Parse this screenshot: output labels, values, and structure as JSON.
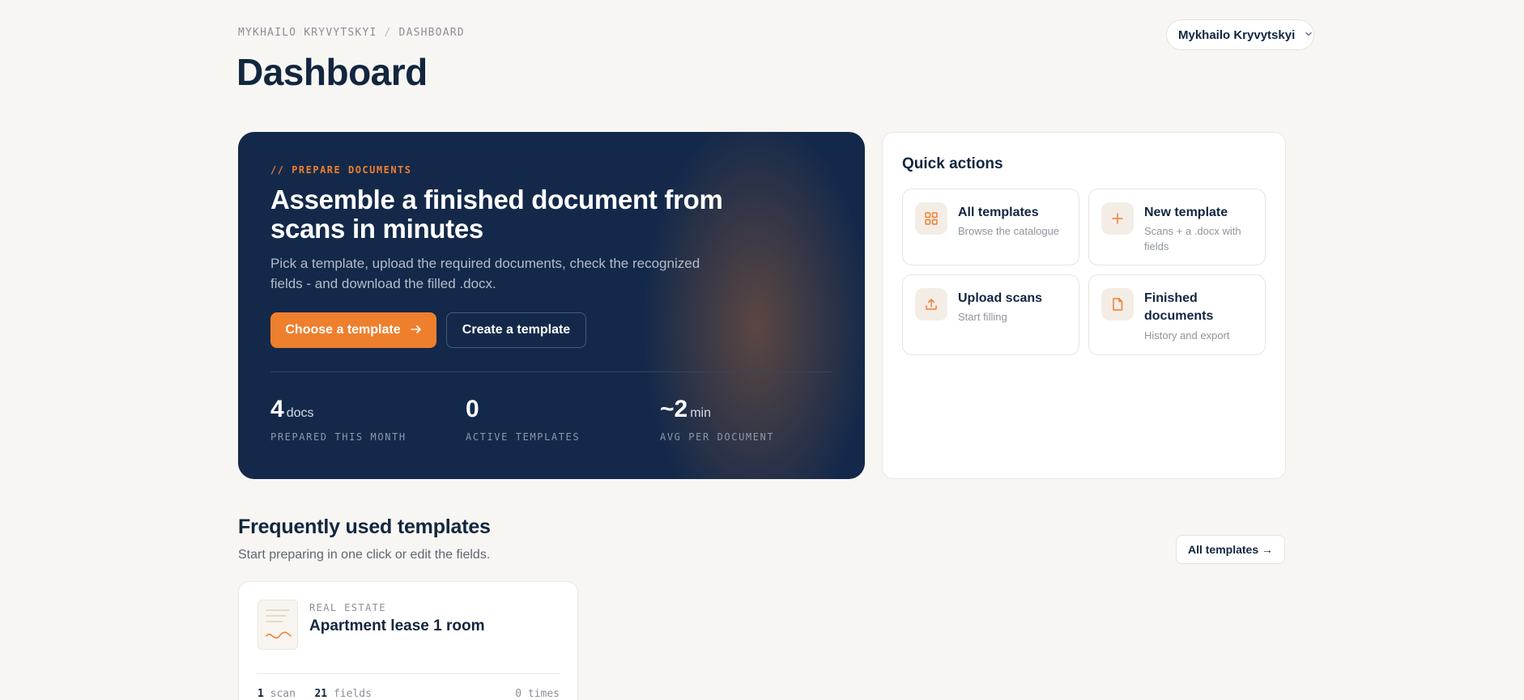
{
  "breadcrumb": {
    "user": "MYKHAILO KRYVYTSKYI",
    "separator": "/",
    "current": "DASHBOARD"
  },
  "page_title": "Dashboard",
  "user_menu": {
    "name": "Mykhailo Kryvytskyi",
    "icon": "chevron-down-icon"
  },
  "hero": {
    "eyebrow": "// PREPARE DOCUMENTS",
    "title": "Assemble a finished document from scans in minutes",
    "description": "Pick a template, upload the required documents, check the recognized fields - and download the filled .docx.",
    "primary_button": "Choose a template",
    "primary_button_icon": "arrow-right-icon",
    "secondary_button": "Create a template",
    "stats": [
      {
        "value": "4",
        "unit": "docs",
        "label": "PREPARED THIS MONTH"
      },
      {
        "value": "0",
        "unit": "",
        "label": "ACTIVE TEMPLATES"
      },
      {
        "value": "~2",
        "unit": "min",
        "label": "AVG PER DOCUMENT"
      }
    ]
  },
  "quick_actions": {
    "title": "Quick actions",
    "items": [
      {
        "title": "All templates",
        "subtitle": "Browse the catalogue",
        "icon": "grid-icon"
      },
      {
        "title": "New template",
        "subtitle": "Scans + a .docx with fields",
        "icon": "plus-icon"
      },
      {
        "title": "Upload scans",
        "subtitle": "Start filling",
        "icon": "upload-icon"
      },
      {
        "title": "Finished documents",
        "subtitle": "History and export",
        "icon": "document-icon"
      }
    ]
  },
  "frequent": {
    "title": "Frequently used templates",
    "subtitle": "Start preparing in one click or edit the fields.",
    "all_button": "All templates →",
    "templates": [
      {
        "category": "REAL ESTATE",
        "name": "Apartment lease 1 room",
        "scans_count": "1",
        "scans_label": "scan",
        "fields_count": "21",
        "fields_label": "fields",
        "times": "0 times"
      }
    ]
  },
  "colors": {
    "accent": "#ee7f2d",
    "navy": "#14294a",
    "background": "#f8f6f3"
  }
}
